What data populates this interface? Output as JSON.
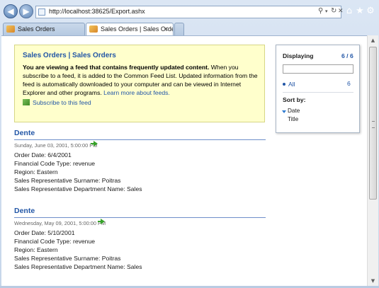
{
  "browser": {
    "url": "http://localhost:38625/Export.ashx",
    "tabs": [
      {
        "label": "Sales Orders",
        "active": false
      },
      {
        "label": "Sales Orders | Sales Orders",
        "active": true
      }
    ],
    "close_glyph": "✕",
    "icons": [
      "back-icon",
      "forward-icon",
      "search-icon",
      "refresh-icon",
      "stop-icon",
      "home-icon",
      "favorites-icon",
      "tools-icon"
    ]
  },
  "feed": {
    "title": "Sales Orders | Sales Orders",
    "msg_bold": "You are viewing a feed that contains frequently updated content.",
    "msg_rest": " When you subscribe to a feed, it is added to the Common Feed List. Updated information from the feed is automatically downloaded to your computer and can be viewed in Internet Explorer and other programs. ",
    "learn_more": "Learn more about feeds.",
    "subscribe": "Subscribe to this feed"
  },
  "panel": {
    "displaying_label": "Displaying",
    "count": "6 / 6",
    "filter_all": "All",
    "filter_all_count": "6",
    "sort_label": "Sort by:",
    "sort_options": [
      "Date",
      "Title"
    ]
  },
  "entries": [
    {
      "title": "Dente",
      "date": "Sunday, June 03, 2001, 5:00:00 PM",
      "lines": [
        "Order Date: 6/4/2001",
        "Financial Code Type: revenue",
        "Region: Eastern",
        "Sales Representative Surname: Poitras",
        "Sales Representative Department Name: Sales"
      ]
    },
    {
      "title": "Dente",
      "date": "Wednesday, May 09, 2001, 5:00:00 PM",
      "lines": [
        "Order Date: 5/10/2001",
        "Financial Code Type: revenue",
        "Region: Eastern",
        "Sales Representative Surname: Poitras",
        "Sales Representative Department Name: Sales"
      ]
    }
  ],
  "colors": {
    "link": "#2256a6",
    "notice_bg": "#ffffcc",
    "arrow": "#37a22a"
  }
}
